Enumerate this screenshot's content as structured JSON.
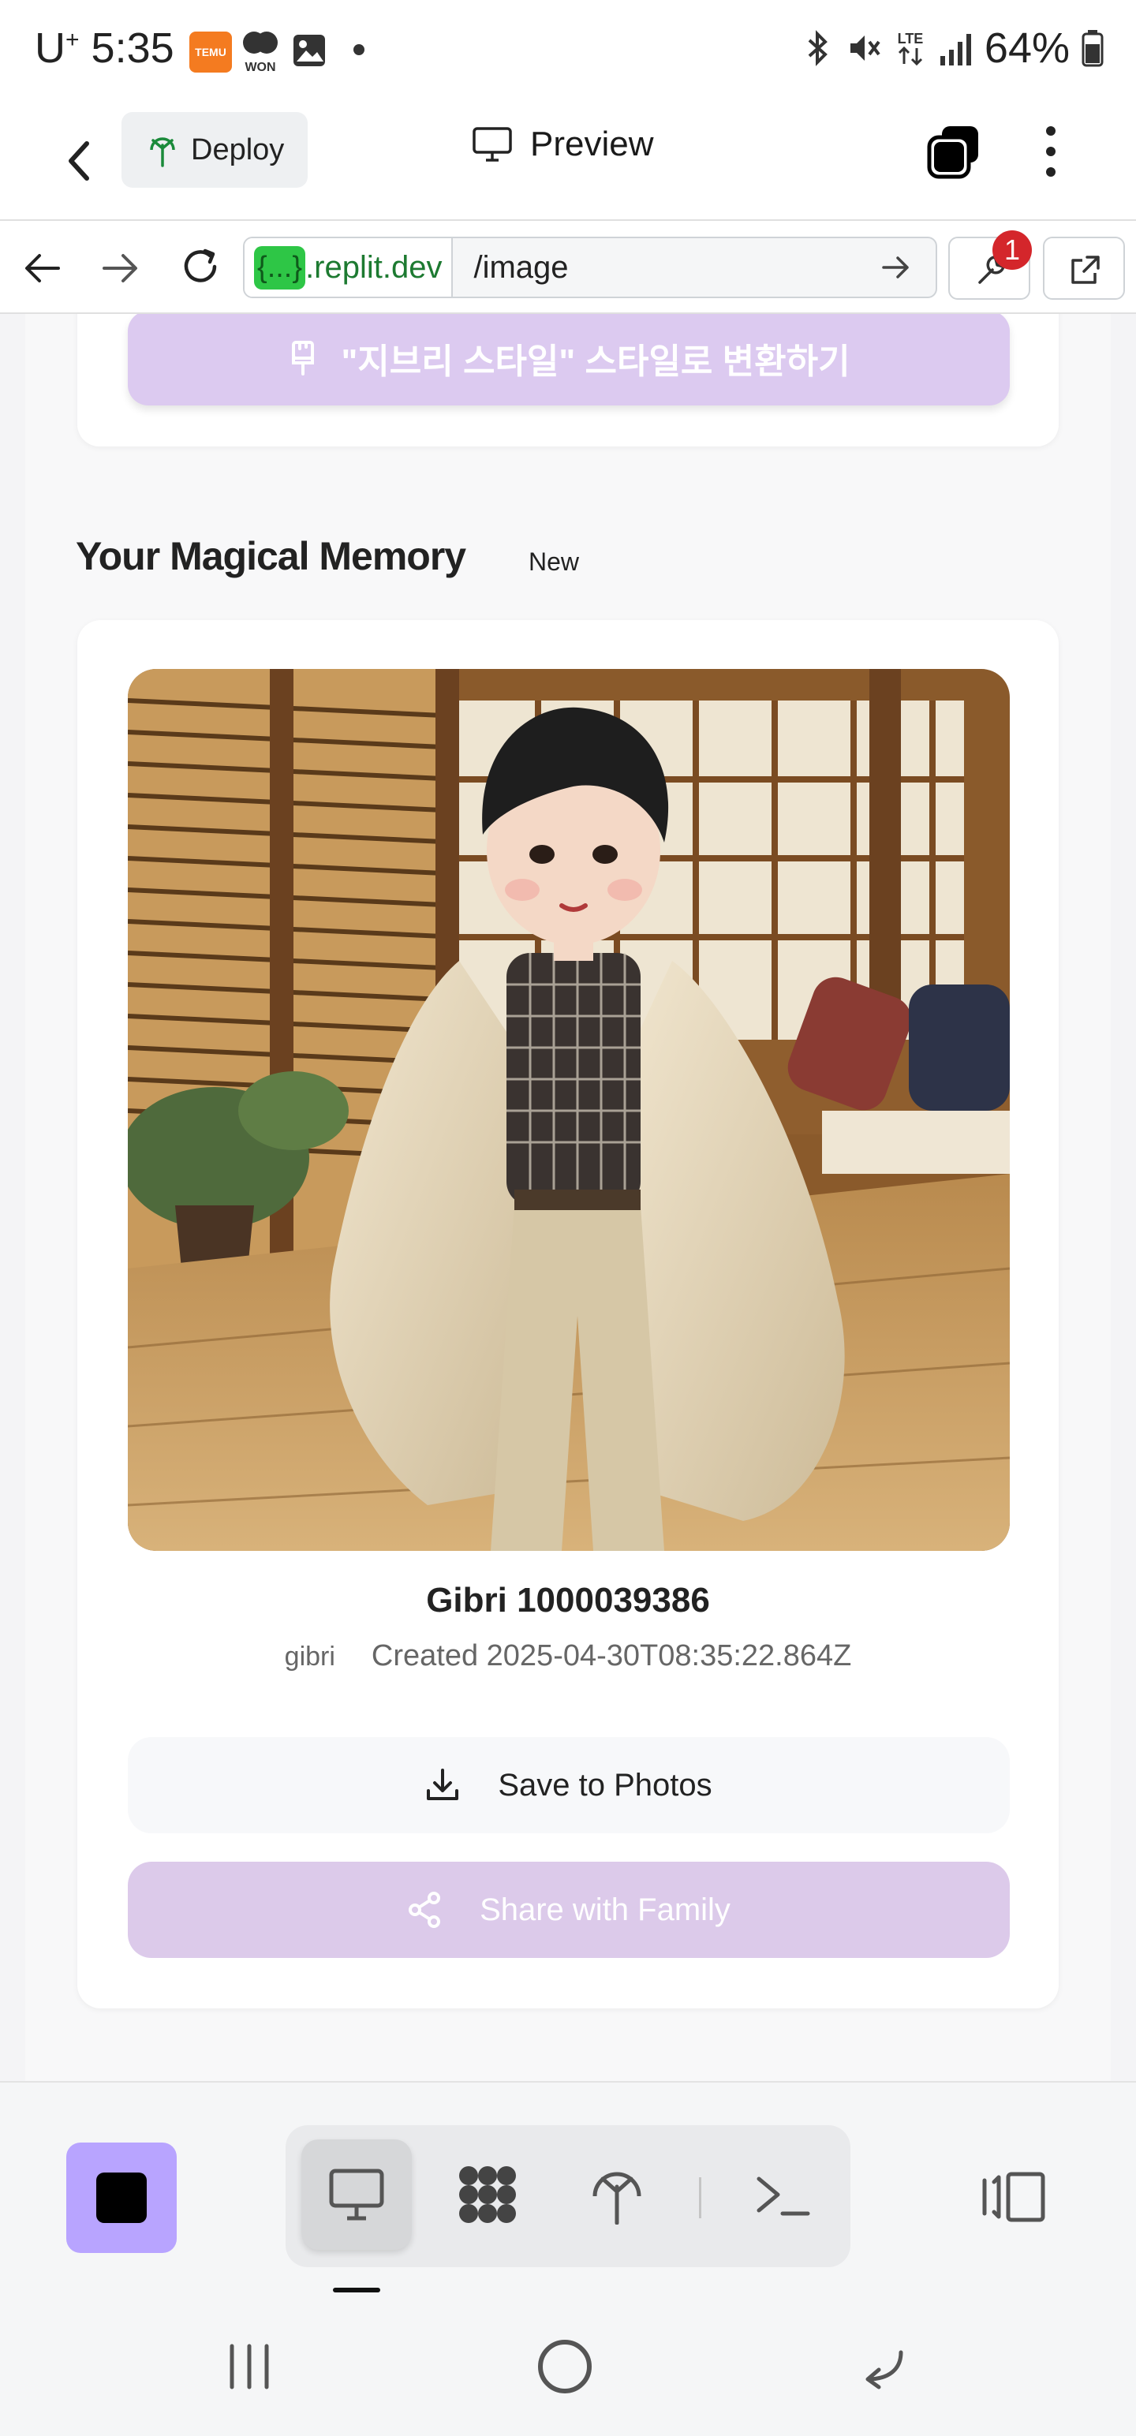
{
  "status_bar": {
    "carrier": "U",
    "carrier_sup": "+",
    "time": "5:35",
    "temu_label": "TEMU",
    "won_label": "WON",
    "battery": "64%"
  },
  "header": {
    "deploy_label": "Deploy",
    "preview_label": "Preview"
  },
  "url_bar": {
    "domain_pill": "{...}",
    "domain_rest": ".replit.dev",
    "path": "/image",
    "notification_count": "1"
  },
  "content": {
    "convert_button_label": "\"지브리 스타일\" 스타일로 변환하기",
    "section_title": "Your Magical Memory",
    "section_badge": "New",
    "photo_title": "Gibri 1000039386",
    "photo_tag": "gibri",
    "photo_created": "Created 2025-04-30T08:35:22.864Z",
    "save_label": "Save to Photos",
    "share_label": "Share with Family"
  },
  "colors": {
    "accent_purple": "#dccaf0",
    "stop_button": "#b8a4ff",
    "url_green": "#2ec646"
  },
  "icons": {
    "toolbar": [
      "desktop-icon",
      "grid-icon",
      "deploy-icon",
      "terminal-icon"
    ]
  }
}
